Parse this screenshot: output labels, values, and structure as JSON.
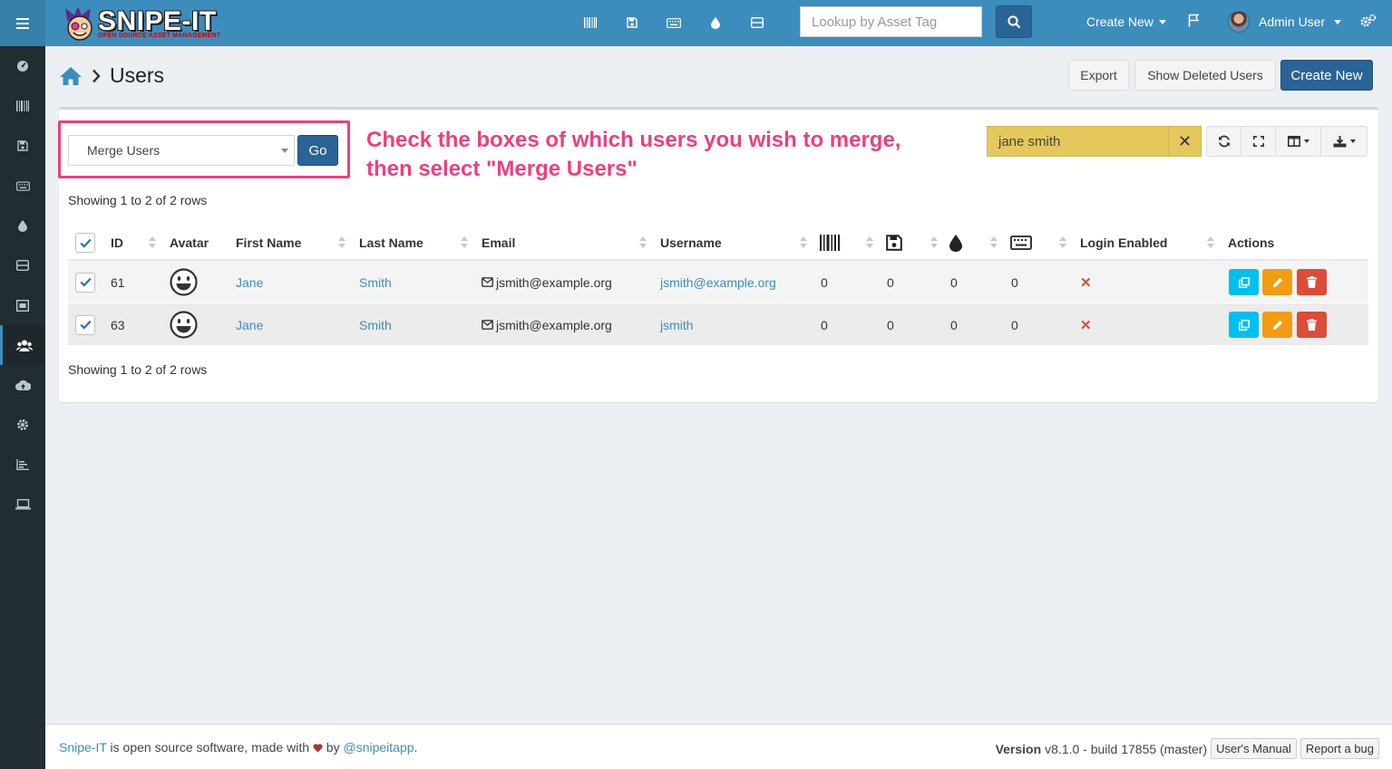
{
  "header": {
    "logo_text": "SNIPE-IT",
    "logo_subtext": "OPEN SOURCE ASSET MANAGEMENT",
    "lookup_placeholder": "Lookup by Asset Tag",
    "create_new": "Create New",
    "user_name": "Admin User",
    "top_icons": [
      "barcode-icon",
      "floppy-icon",
      "keyboard-icon",
      "drop-icon",
      "server-icon"
    ]
  },
  "sidebar": {
    "items": [
      "dashboard-icon",
      "barcode-icon",
      "floppy-icon",
      "keyboard-icon",
      "drop-icon",
      "server-icon",
      "kit-icon",
      "users-icon",
      "cloud-upload-icon",
      "gear-icon",
      "reports-icon",
      "laptop-icon"
    ],
    "active_index": 7
  },
  "page": {
    "title": "Users",
    "export": "Export",
    "show_deleted": "Show Deleted Users",
    "create_new": "Create New"
  },
  "toolbar": {
    "bulk_action": "Merge Users",
    "go": "Go",
    "search_value": "jane smith",
    "clear": "✕"
  },
  "annotation": {
    "line1": "Check the boxes of which users you wish to merge,",
    "line2": "then select \"Merge Users\""
  },
  "table": {
    "showing_top": "Showing 1 to 2 of 2 rows",
    "showing_bottom": "Showing 1 to 2 of 2 rows",
    "headers": {
      "id": "ID",
      "avatar": "Avatar",
      "first_name": "First Name",
      "last_name": "Last Name",
      "email": "Email",
      "username": "Username",
      "login_enabled": "Login Enabled",
      "actions": "Actions"
    },
    "rows": [
      {
        "id": "61",
        "first": "Jane",
        "last": "Smith",
        "email": "jsmith@example.org",
        "username": "jsmith@example.org",
        "assets": "0",
        "licenses": "0",
        "consumables": "0",
        "accessories": "0",
        "login": "✕"
      },
      {
        "id": "63",
        "first": "Jane",
        "last": "Smith",
        "email": "jsmith@example.org",
        "username": "jsmith",
        "assets": "0",
        "licenses": "0",
        "consumables": "0",
        "accessories": "0",
        "login": "✕"
      }
    ]
  },
  "footer": {
    "brand": "Snipe-IT",
    "text1": " is open source software, made with ",
    "text2": " by ",
    "handle": "@snipeitapp",
    "period": ".",
    "version_label": "Version",
    "version": " v8.1.0 - build 17855 (master)",
    "manual": "User's Manual",
    "bug": "Report a bug"
  },
  "colors": {
    "header": "#3c8dbc",
    "sidebar": "#222d32",
    "annotation": "#ef3e7f",
    "search_highlight": "#e5c85c"
  }
}
